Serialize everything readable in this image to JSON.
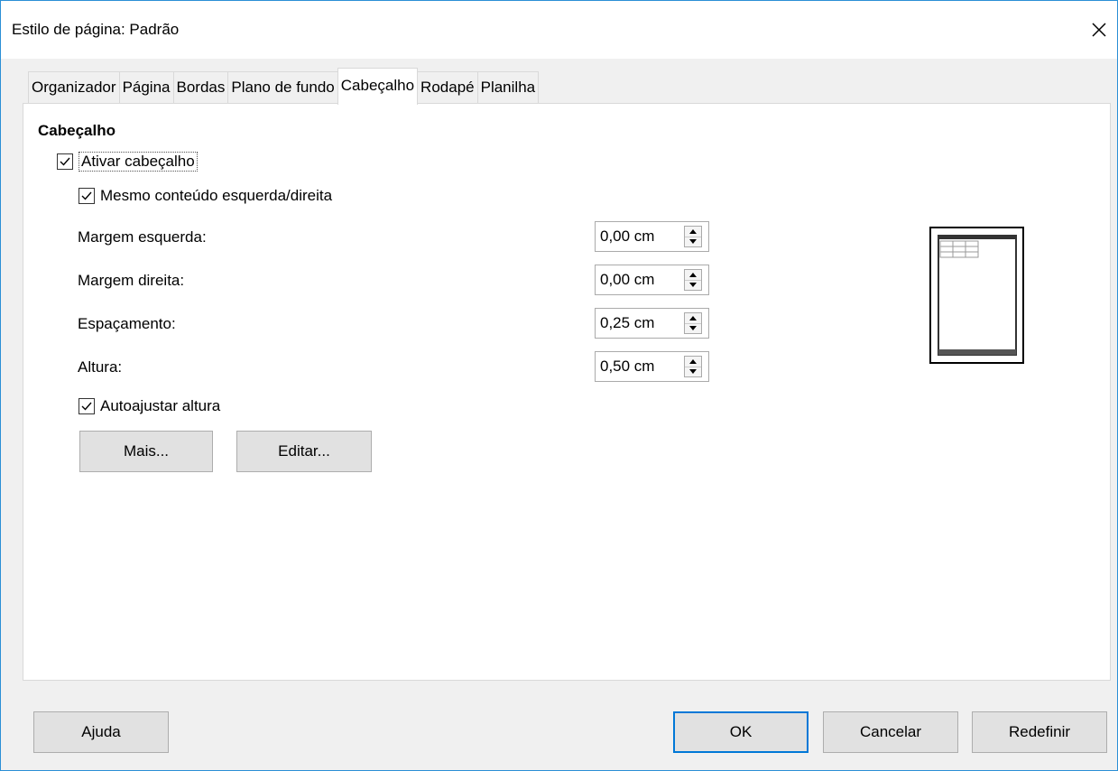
{
  "window": {
    "title": "Estilo de página: Padrão"
  },
  "tabs": [
    {
      "label": "Organizador",
      "active": false
    },
    {
      "label": "Página",
      "active": false
    },
    {
      "label": "Bordas",
      "active": false
    },
    {
      "label": "Plano de fundo",
      "active": false
    },
    {
      "label": "Cabeçalho",
      "active": true
    },
    {
      "label": "Rodapé",
      "active": false
    },
    {
      "label": "Planilha",
      "active": false
    }
  ],
  "header": {
    "section_title": "Cabeçalho",
    "enable_header": {
      "label": "Ativar cabeçalho",
      "checked": true
    },
    "same_content": {
      "label": "Mesmo conteúdo esquerda/direita",
      "checked": true
    },
    "fields": [
      {
        "label": "Margem esquerda:",
        "value": "0,00 cm"
      },
      {
        "label": "Margem direita:",
        "value": "0,00 cm"
      },
      {
        "label": "Espaçamento:",
        "value": "0,25 cm"
      },
      {
        "label": "Altura:",
        "value": "0,50 cm"
      }
    ],
    "autofit": {
      "label": "Autoajustar altura",
      "checked": true
    },
    "more_button": "Mais...",
    "edit_button": "Editar..."
  },
  "footer_buttons": {
    "help": "Ajuda",
    "ok": "OK",
    "cancel": "Cancelar",
    "reset": "Redefinir"
  },
  "colors": {
    "accent": "#0078d7",
    "window_border": "#2b8fd6"
  }
}
